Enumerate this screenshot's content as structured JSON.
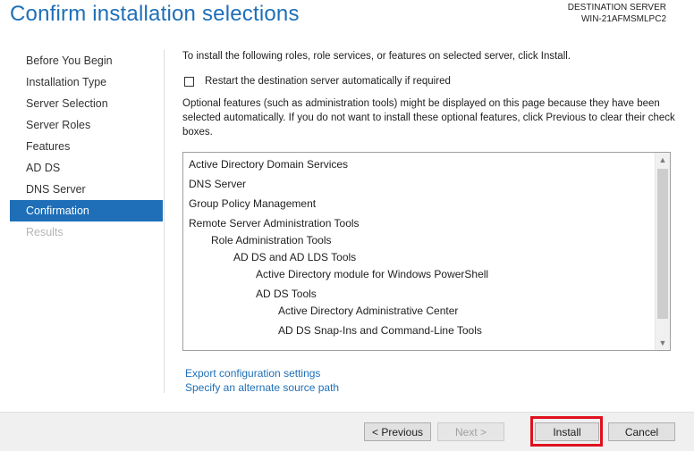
{
  "header": {
    "title": "Confirm installation selections",
    "destination_label": "DESTINATION SERVER",
    "destination_name": "WIN-21AFMSMLPC2"
  },
  "nav": {
    "items": [
      {
        "label": "Before You Begin",
        "state": "normal"
      },
      {
        "label": "Installation Type",
        "state": "normal"
      },
      {
        "label": "Server Selection",
        "state": "normal"
      },
      {
        "label": "Server Roles",
        "state": "normal"
      },
      {
        "label": "Features",
        "state": "normal"
      },
      {
        "label": "AD DS",
        "state": "normal"
      },
      {
        "label": "DNS Server",
        "state": "normal"
      },
      {
        "label": "Confirmation",
        "state": "selected"
      },
      {
        "label": "Results",
        "state": "disabled"
      }
    ]
  },
  "content": {
    "intro": "To install the following roles, role services, or features on selected server, click Install.",
    "restart_label": "Restart the destination server automatically if required",
    "restart_checked": false,
    "optional_text": "Optional features (such as administration tools) might be displayed on this page because they have been selected automatically. If you do not want to install these optional features, click Previous to clear their check boxes."
  },
  "selections": [
    {
      "label": "Active Directory Domain Services",
      "level": 0
    },
    {
      "label": "DNS Server",
      "level": 0
    },
    {
      "label": "Group Policy Management",
      "level": 0
    },
    {
      "label": "Remote Server Administration Tools",
      "level": 0
    },
    {
      "label": "Role Administration Tools",
      "level": 1
    },
    {
      "label": "AD DS and AD LDS Tools",
      "level": 2
    },
    {
      "label": "Active Directory module for Windows PowerShell",
      "level": 3
    },
    {
      "label": "AD DS Tools",
      "level": 3
    },
    {
      "label": "Active Directory Administrative Center",
      "level": 4
    },
    {
      "label": "AD DS Snap-Ins and Command-Line Tools",
      "level": 4
    }
  ],
  "links": {
    "export": "Export configuration settings",
    "alternate_source": "Specify an alternate source path"
  },
  "buttons": {
    "previous": "< Previous",
    "next": "Next >",
    "install": "Install",
    "cancel": "Cancel"
  },
  "colors": {
    "accent": "#1e6fb8",
    "highlight": "#e0101f"
  }
}
